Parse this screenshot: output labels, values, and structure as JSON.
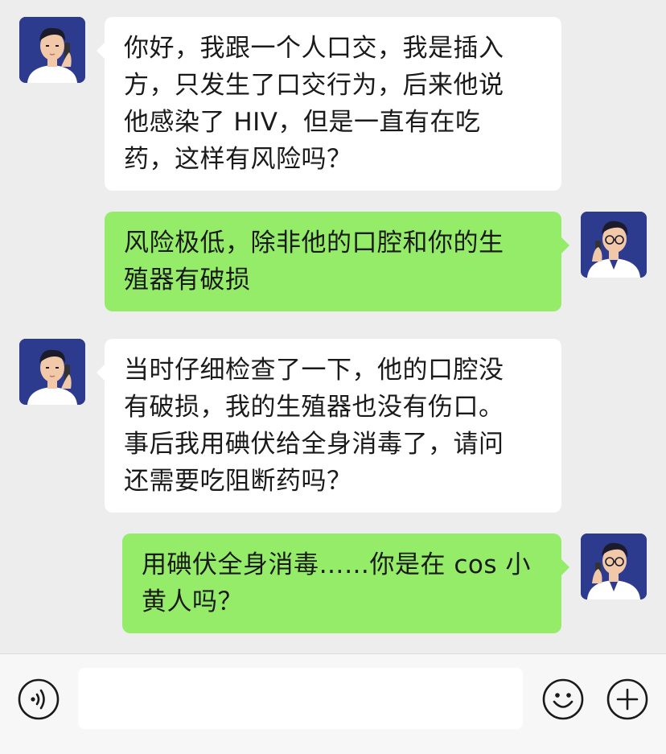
{
  "messages": [
    {
      "sender": "user",
      "avatar": "patient-avatar",
      "lines": [
        "你好，我跟一个人口交，我是插入",
        "方，只发生了口交行为，后来他说",
        "他感染了 HIV，但是一直有在吃",
        "药，这样有风险吗？"
      ]
    },
    {
      "sender": "doctor",
      "avatar": "doctor-avatar",
      "lines": [
        "风险极低，除非他的口腔和你的生",
        "殖器有破损"
      ]
    },
    {
      "sender": "user",
      "avatar": "patient-avatar",
      "lines": [
        "当时仔细检查了一下，他的口腔没",
        "有破损，我的生殖器也没有伤口。",
        "事后我用碘伏给全身消毒了，请问",
        "还需要吃阻断药吗？"
      ]
    },
    {
      "sender": "doctor",
      "avatar": "doctor-avatar",
      "lines": [
        "用碘伏全身消毒……你是在 cos 小",
        "黄人吗？"
      ]
    }
  ],
  "input_bar": {
    "voice_icon": "voice-icon",
    "emoji_icon": "emoji-icon",
    "plus_icon": "plus-icon",
    "input_value": ""
  },
  "colors": {
    "background": "#ededed",
    "incoming_bubble": "#ffffff",
    "outgoing_bubble": "#95ec69",
    "avatar_bg": "#2d3b8f",
    "footer_bg": "#f7f7f7"
  }
}
